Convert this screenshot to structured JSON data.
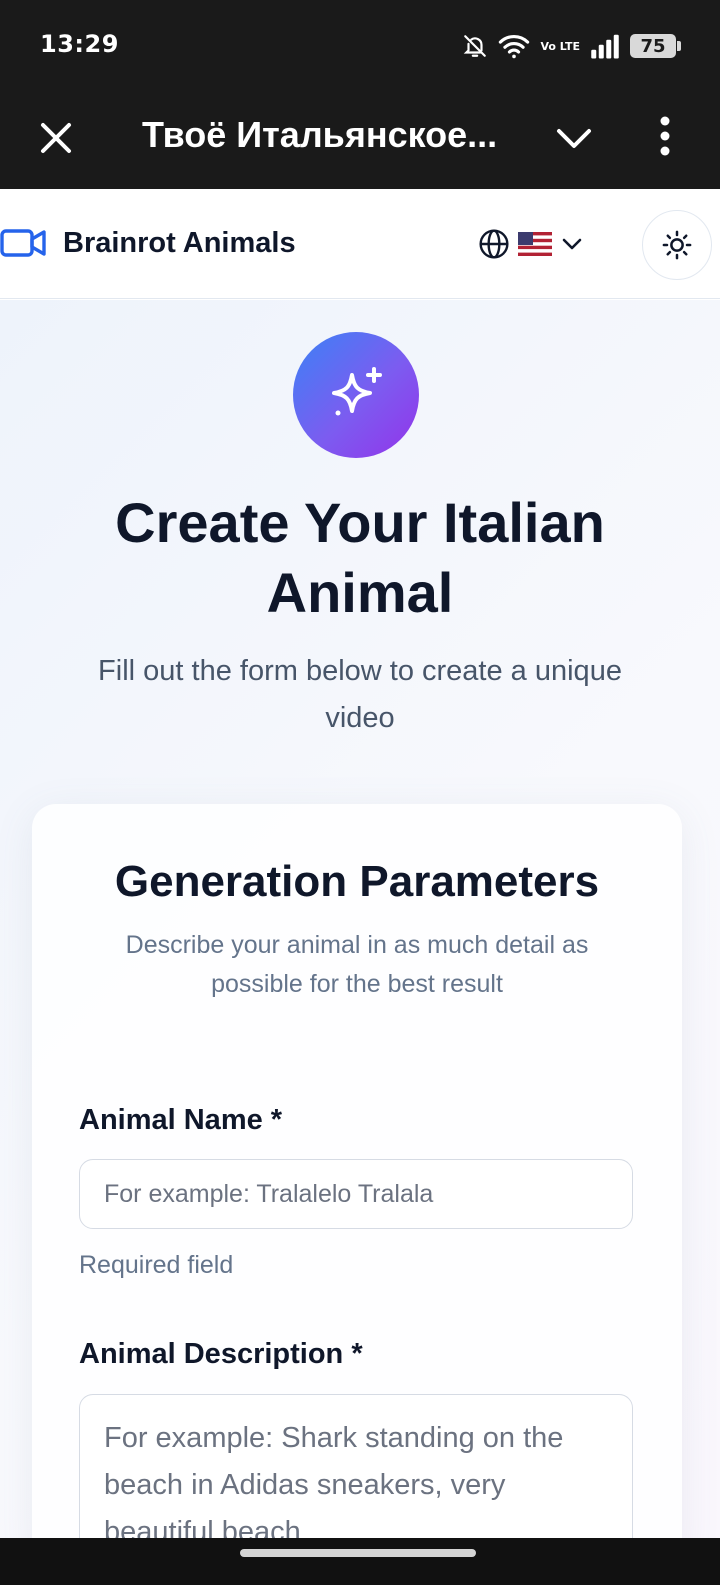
{
  "status_bar": {
    "time": "13:29",
    "volte": "Vo LTE",
    "battery": "75",
    "icons": [
      "bell-off-icon",
      "wifi-icon",
      "volte-icon",
      "signal-icon",
      "battery-icon"
    ]
  },
  "browser": {
    "title": "Твоё Итальянское...",
    "icons": [
      "close-icon",
      "chevron-down-icon",
      "more-vertical-icon"
    ]
  },
  "header": {
    "app_name": "Brainrot Animals",
    "logo_icon": "video-camera-icon",
    "language_icon": "globe-icon",
    "flag": "us-flag",
    "theme_icon": "sun-icon",
    "brand_color": "#2563eb"
  },
  "hero": {
    "icon": "sparkles-icon",
    "title": "Create Your Italian Animal",
    "subtitle": "Fill out the form below to create a unique video",
    "gradient": [
      "#3b82f6",
      "#9333ea"
    ]
  },
  "form": {
    "title": "Generation Parameters",
    "description": "Describe your animal in as much detail as possible for the best result",
    "fields": {
      "name": {
        "label": "Animal Name *",
        "placeholder": "For example: Tralalelo Tralala",
        "value": "",
        "helper": "Required field"
      },
      "description": {
        "label": "Animal Description *",
        "placeholder": "For example: Shark standing on the beach in Adidas sneakers, very beautiful beach",
        "value": ""
      }
    }
  }
}
